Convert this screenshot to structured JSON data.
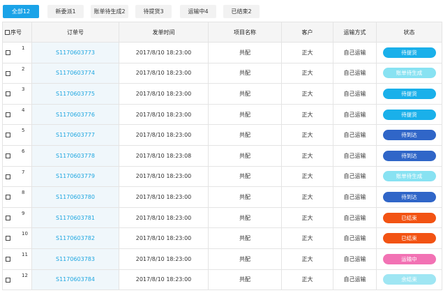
{
  "tabs": [
    {
      "label": "全部12"
    },
    {
      "label": "新委派1"
    },
    {
      "label": "账单待生成2"
    },
    {
      "label": "待提货3"
    },
    {
      "label": "运输中4"
    },
    {
      "label": "已结束2"
    }
  ],
  "table": {
    "headers": {
      "index": "序号",
      "order": "订单号",
      "time": "发单时间",
      "project": "项目名称",
      "customer": "客户",
      "transport": "运输方式",
      "status": "状态"
    },
    "rows": [
      {
        "index": "1",
        "order": "S1170603773",
        "time": "2017/8/10 18:23:00",
        "project": "共配",
        "customer": "正大",
        "transport": "自己运输",
        "status": "待提货",
        "status_color": "#1ab0ea"
      },
      {
        "index": "2",
        "order": "S1170603774",
        "time": "2017/8/10 18:23:00",
        "project": "共配",
        "customer": "正大",
        "transport": "自己运输",
        "status": "账单待生成",
        "status_color": "#88e2f2"
      },
      {
        "index": "3",
        "order": "S1170603775",
        "time": "2017/8/10 18:23:00",
        "project": "共配",
        "customer": "正大",
        "transport": "自己运输",
        "status": "待提货",
        "status_color": "#1ab0ea"
      },
      {
        "index": "4",
        "order": "S1170603776",
        "time": "2017/8/10 18:23:00",
        "project": "共配",
        "customer": "正大",
        "transport": "自己运输",
        "status": "待提货",
        "status_color": "#1ab0ea"
      },
      {
        "index": "5",
        "order": "S1170603777",
        "time": "2017/8/10 18:23:00",
        "project": "共配",
        "customer": "正大",
        "transport": "自己运输",
        "status": "待到达",
        "status_color": "#3066c8"
      },
      {
        "index": "6",
        "order": "S1170603778",
        "time": "2017/8/10 18:23:08",
        "project": "共配",
        "customer": "正大",
        "transport": "自己运输",
        "status": "待到达",
        "status_color": "#3066c8"
      },
      {
        "index": "7",
        "order": "S1170603779",
        "time": "2017/8/10 18:23:00",
        "project": "共配",
        "customer": "正大",
        "transport": "自己运输",
        "status": "账单待生成",
        "status_color": "#88e2f2"
      },
      {
        "index": "8",
        "order": "S1170603780",
        "time": "2017/8/10 18:23:00",
        "project": "共配",
        "customer": "正大",
        "transport": "自己运输",
        "status": "待到达",
        "status_color": "#3066c8"
      },
      {
        "index": "9",
        "order": "S1170603781",
        "time": "2017/8/10 18:23:00",
        "project": "共配",
        "customer": "正大",
        "transport": "自己运输",
        "status": "已结束",
        "status_color": "#f25313"
      },
      {
        "index": "10",
        "order": "S1170603782",
        "time": "2017/8/10 18:23:00",
        "project": "共配",
        "customer": "正大",
        "transport": "自己运输",
        "status": "已结束",
        "status_color": "#f25313"
      },
      {
        "index": "11",
        "order": "S1170603783",
        "time": "2017/8/10 18:23:00",
        "project": "共配",
        "customer": "正大",
        "transport": "自己运输",
        "status": "运输中",
        "status_color": "#f272b4"
      },
      {
        "index": "12",
        "order": "S1170603784",
        "time": "2017/8/10 18:23:00",
        "project": "共配",
        "customer": "正大",
        "transport": "自己运输",
        "status": "余结束",
        "status_color": "#9fe6f3"
      }
    ]
  }
}
